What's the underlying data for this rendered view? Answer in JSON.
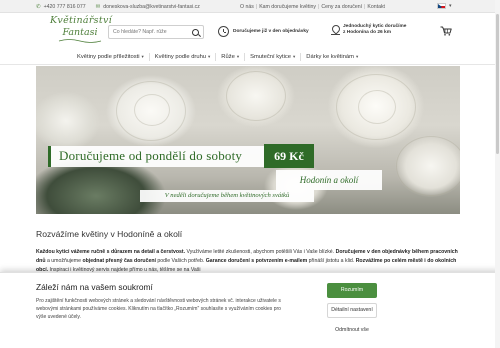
{
  "topbar": {
    "phone": "+420 777 816 077",
    "email": "doneskova-sluzba@kvetinarstvi-fantasi.cz",
    "links": [
      "O nás",
      "Kam doručujeme květiny",
      "Ceny za doručení",
      "Kontakt"
    ],
    "language": "CZ"
  },
  "logo": {
    "line1": "Květinářství",
    "line2": "Fantasi"
  },
  "search": {
    "placeholder": "Co hledáte? Např. růže",
    "value": ""
  },
  "delivery_today": {
    "text": "Doručujeme již v den objednávky"
  },
  "delivery_area": {
    "line1": "Jednoduchý kytic doručíme",
    "line2": "z Hodonína do 26 km"
  },
  "nav": {
    "items": [
      {
        "label": "Květiny podle příležitosti",
        "has_dropdown": true
      },
      {
        "label": "Květiny podle druhu",
        "has_dropdown": true
      },
      {
        "label": "Růže",
        "has_dropdown": true
      },
      {
        "label": "Smuteční kytice",
        "has_dropdown": true
      },
      {
        "label": "Dárky ke květinám",
        "has_dropdown": true
      }
    ]
  },
  "hero": {
    "headline": "Doručujeme od pondělí do soboty",
    "price": "69 Kč",
    "location": "Hodonín a okolí",
    "sunday_note": "V neděli doručujeme během květinových svátků"
  },
  "main": {
    "heading": "Rozvážíme květiny v Hodoníně a okolí",
    "paragraph": {
      "bold1": "Každou kytici vážeme ručně s důrazem na detail a čerstvost.",
      "text1": " Využíváme letité zkušenosti, abychom potěšili Vás i Vaše blízké. ",
      "bold2": "Doručujeme v den objednávky během pracovních dnů",
      "text2": " a umožňujeme ",
      "bold3": "objednat přesný čas doručení",
      "text3": " podle Vašich potřeb. ",
      "bold4": "Garance doručení s potvrzením e-mailem",
      "text4": " přináší jistotu a klid. ",
      "bold5": "Rozvážíme po celém městě i do okolních obcí.",
      "text5": " Inspiraci i květinový servis najdete přímo u nás, těšíme se na Vaši"
    }
  },
  "cookie": {
    "title": "Záleží nám na vašem soukromí",
    "text": "Pro zajištění funkčnosti webových stránek a sledování návštěvnosti webových stránek vč. interakce uživatele s webovými stránkami používáme cookies. Kliknutím na tlačítko „Rozumím\" souhlasíte s využíváním cookies pro výše uvedené účely.",
    "accept_label": "Rozumím",
    "settings_label": "Détailní nastavení",
    "reject_label": "Odmítnout vše"
  },
  "colors": {
    "brand_green": "#2f6b28",
    "button_green": "#4b8f3f"
  },
  "icons": [
    "phone-icon",
    "mail-icon",
    "search-icon",
    "clock-icon",
    "map-pin-icon",
    "cart-icon",
    "chevron-down-icon"
  ]
}
